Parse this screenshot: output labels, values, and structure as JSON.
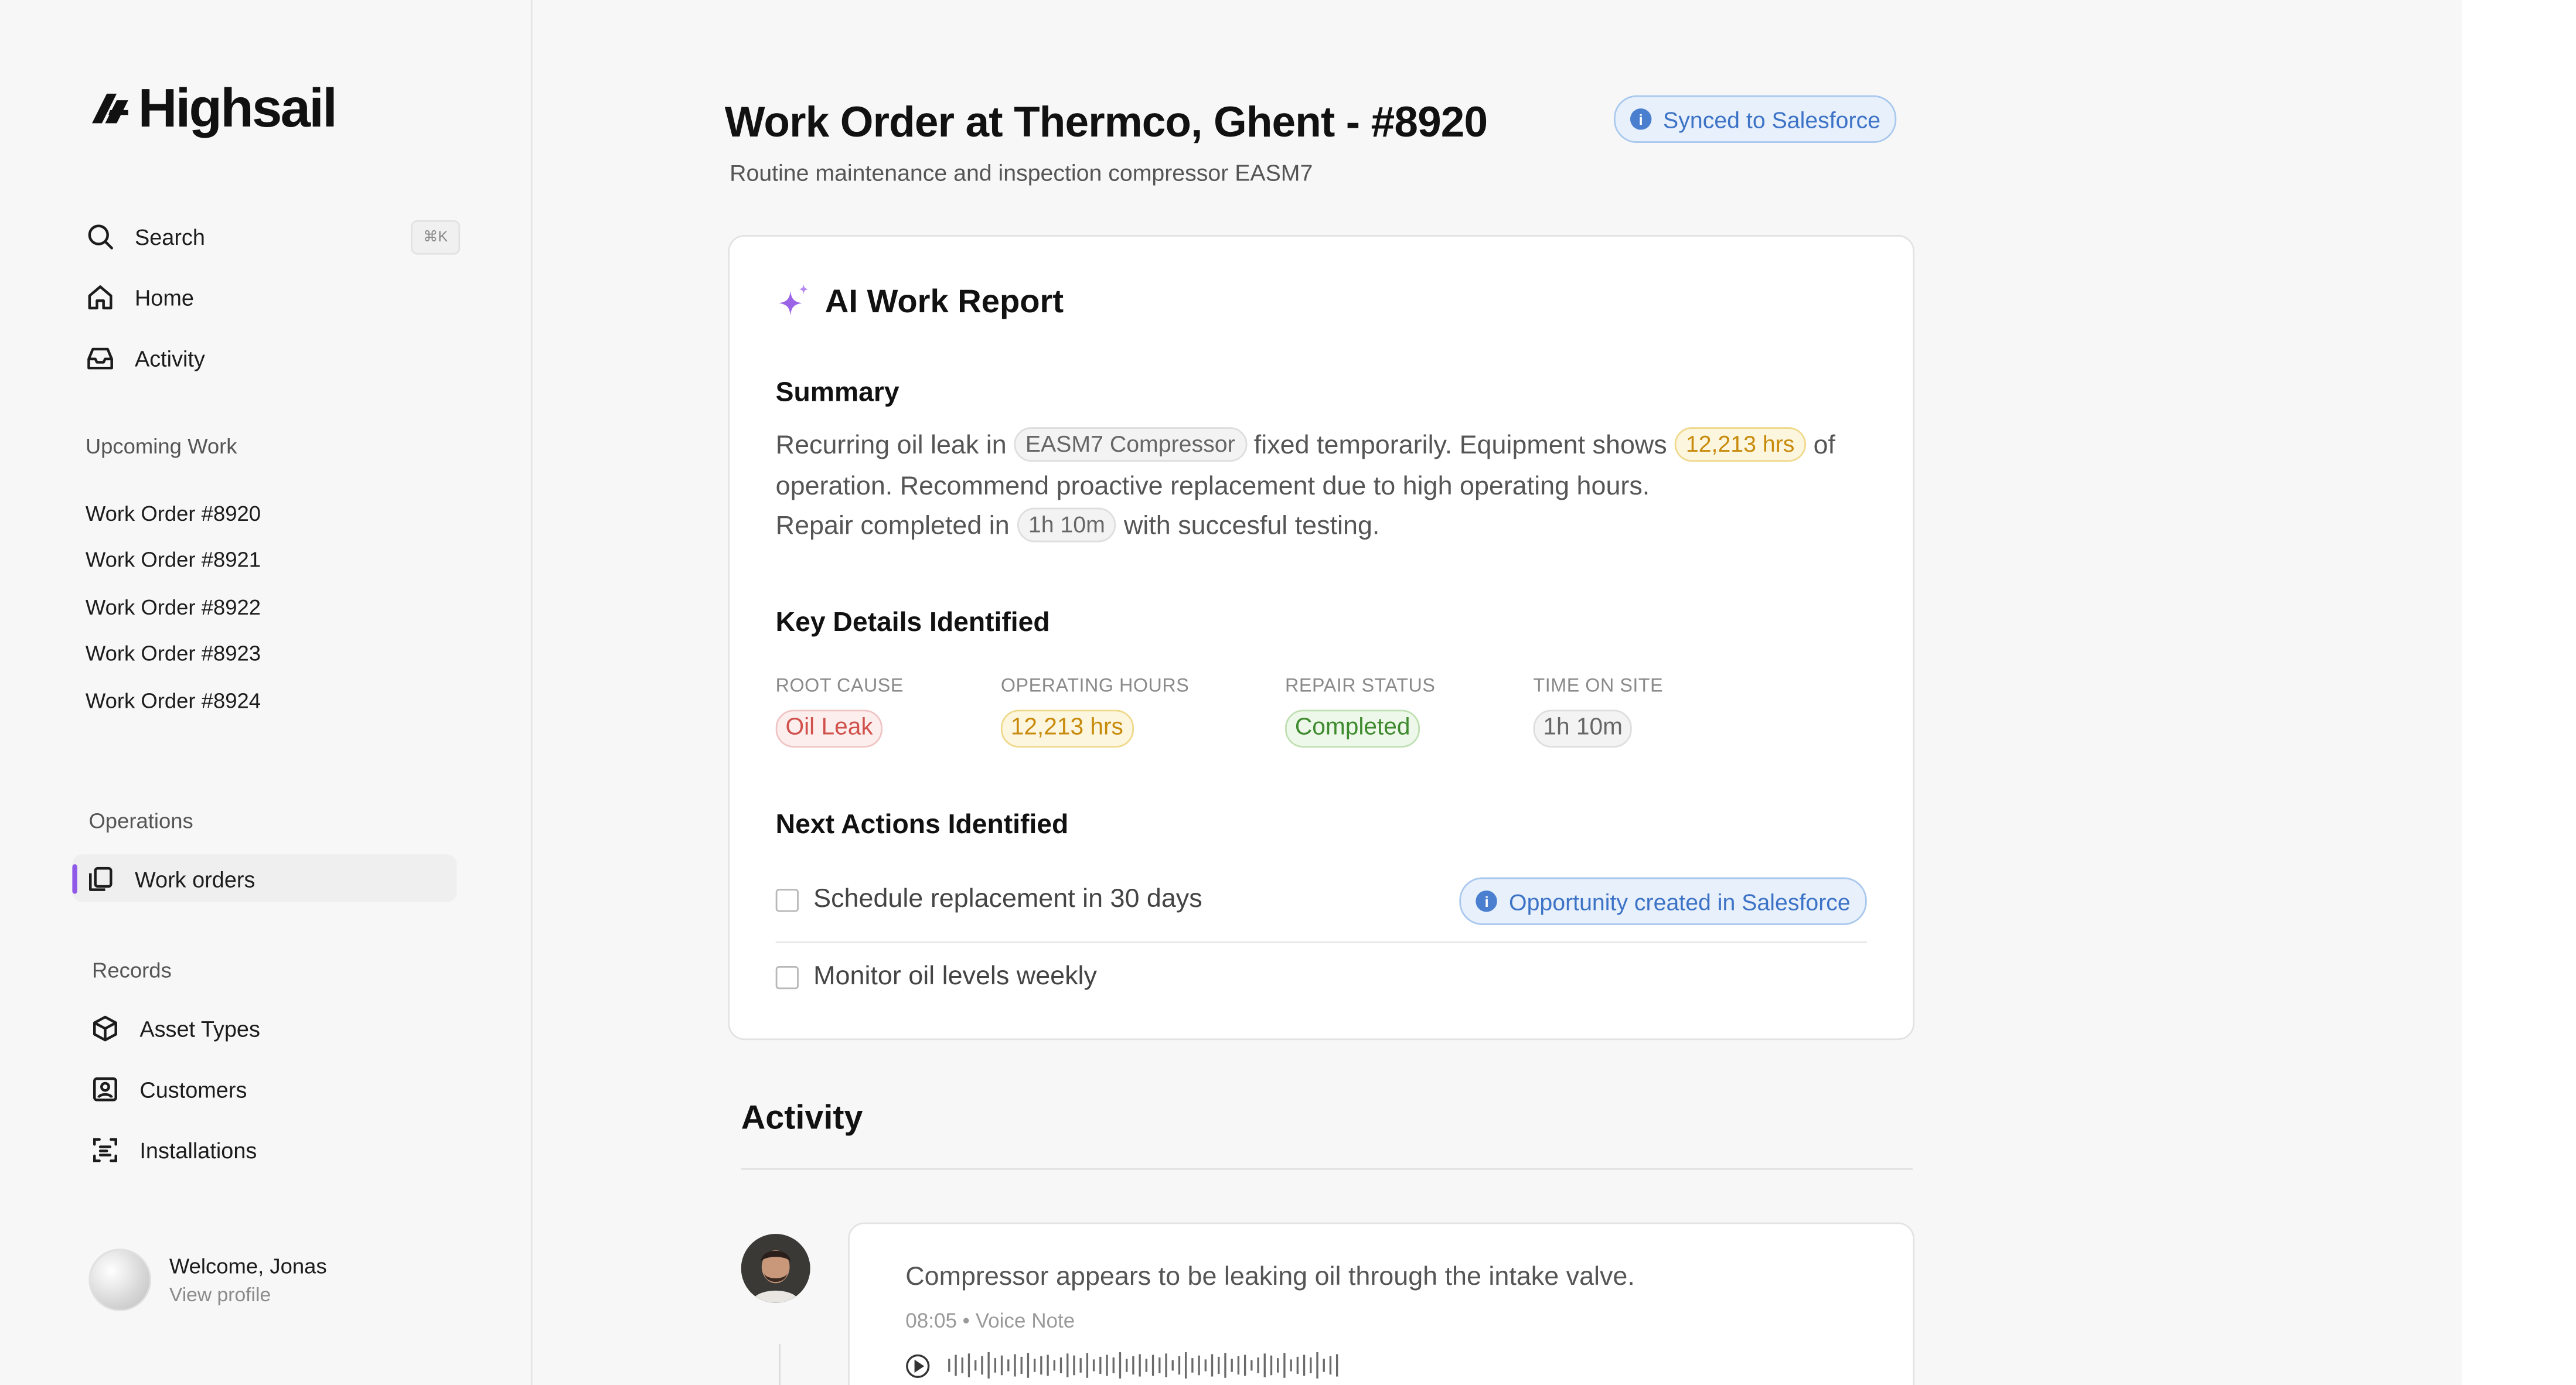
{
  "brand": {
    "name": "Highsail"
  },
  "sidebar": {
    "search": {
      "label": "Search",
      "shortcut": "⌘K"
    },
    "home": {
      "label": "Home"
    },
    "activity": {
      "label": "Activity"
    },
    "upcoming": {
      "label": "Upcoming Work",
      "items": [
        "Work Order #8920",
        "Work Order #8921",
        "Work Order #8922",
        "Work Order #8923",
        "Work Order #8924"
      ]
    },
    "operations": {
      "label": "Operations",
      "work_orders": "Work orders"
    },
    "records": {
      "label": "Records",
      "asset_types": "Asset Types",
      "customers": "Customers",
      "installations": "Installations"
    },
    "profile": {
      "welcome": "Welcome, Jonas",
      "view": "View profile"
    }
  },
  "header": {
    "title": "Work Order at Thermco, Ghent - #8920",
    "subtitle": "Routine maintenance and inspection compressor EASM7",
    "sync_badge": "Synced to Salesforce"
  },
  "report": {
    "title": "AI Work Report",
    "summary": {
      "heading": "Summary",
      "t1": "Recurring oil leak in",
      "chip_equipment": "EASM7 Compressor",
      "t2": "fixed temporarily. Equipment shows",
      "chip_hours": "12,213 hrs",
      "t3": "of operation. Recommend proactive replacement due to high operating hours.",
      "t4": "Repair completed in",
      "chip_time": "1h 10m",
      "t5": "with succesful testing."
    },
    "key_details": {
      "heading": "Key Details Identified",
      "root_cause": {
        "label": "ROOT CAUSE",
        "value": "Oil Leak"
      },
      "operating_hours": {
        "label": "OPERATING HOURS",
        "value": "12,213 hrs"
      },
      "repair_status": {
        "label": "REPAIR STATUS",
        "value": "Completed"
      },
      "time_on_site": {
        "label": "TIME ON SITE",
        "value": "1h 10m"
      }
    },
    "next_actions": {
      "heading": "Next Actions Identified",
      "items": [
        {
          "label": "Schedule replacement in 30 days",
          "checked": false,
          "badge": "Opportunity created in Salesforce"
        },
        {
          "label": "Monitor oil levels weekly",
          "checked": false
        }
      ]
    }
  },
  "activity": {
    "title": "Activity",
    "entries": [
      {
        "text": "Compressor appears to be leaking oil through the intake valve.",
        "meta": "08:05 • Voice Note"
      }
    ]
  },
  "colors": {
    "accent": "#8f5ae8",
    "salesforce_blue": "#3d73c6",
    "amber": "#c88a0a",
    "red": "#d0504b",
    "green": "#3e8a2e"
  }
}
